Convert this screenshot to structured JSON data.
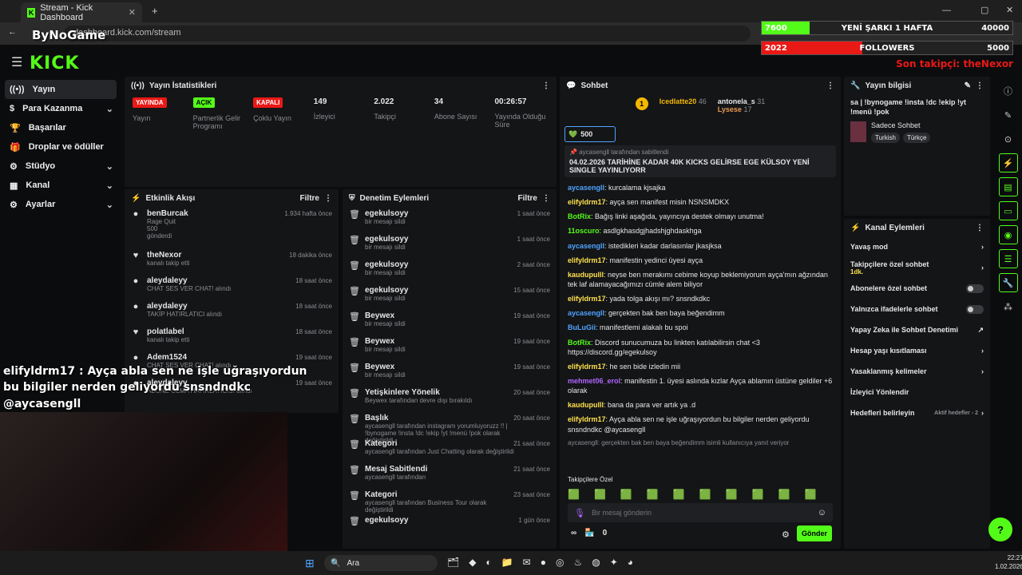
{
  "browser": {
    "tab_title": "Stream - Kick Dashboard",
    "url": "dashboard.kick.com/stream",
    "overlay_brand": "ByNoGame"
  },
  "overlay": {
    "goal1_cur": "7600",
    "goal1_label": "YENİ ŞARKI 1 HAFTA",
    "goal1_max": "40000",
    "goal1_fill": 0.19,
    "goal2_cur": "2022",
    "goal2_label": "FOLLOWERS",
    "goal2_max": "5000",
    "goal2_fill": 0.4,
    "last_follower": "Son takipçi: theNexor"
  },
  "logo": "KICK",
  "sidebar": [
    {
      "label": "Yayın",
      "icon": "broadcast-icon"
    },
    {
      "label": "Para Kazanma",
      "icon": "dollar-icon",
      "chev": true
    },
    {
      "label": "Başarılar",
      "icon": "trophy-icon"
    },
    {
      "label": "Droplar ve ödüller",
      "icon": "gift-icon"
    },
    {
      "label": "Stüdyo",
      "icon": "gear-icon",
      "chev": true
    },
    {
      "label": "Kanal",
      "icon": "channel-icon",
      "chev": true
    },
    {
      "label": "Ayarlar",
      "icon": "settings-icon",
      "chev": true
    }
  ],
  "stats": {
    "title": "Yayın İstatistikleri",
    "items": [
      {
        "badge": "YAYINDA",
        "label": "Yayın",
        "kind": "red"
      },
      {
        "badge": "AÇIK",
        "label": "Partnerlik Gelir Programı",
        "kind": "green"
      },
      {
        "badge": "KAPALI",
        "label": "Çoklu Yayın",
        "kind": "red"
      },
      {
        "value": "149",
        "label": "İzleyici"
      },
      {
        "value": "2.022",
        "label": "Takipçi"
      },
      {
        "value": "34",
        "label": "Abone Sayısı"
      },
      {
        "value": "00:26:57",
        "label": "Yayında Olduğu Süre"
      }
    ]
  },
  "activity": {
    "title": "Etkinlik Akışı",
    "filter": "Filtre",
    "items": [
      {
        "name": "benBurcak",
        "sub": "Rage Quit",
        "sub2": "500",
        "sub3": "gönderdi",
        "time": "1.934 hafta önce"
      },
      {
        "name": "theNexor",
        "sub": "kanalı takip etti",
        "time": "18 dakika önce"
      },
      {
        "name": "aleydaleyy",
        "sub": "CHAT SES VER CHAT! alındı",
        "time": "18 saat önce"
      },
      {
        "name": "aleydaleyy",
        "sub": "TAKİP HATIRLATICI alındı",
        "time": "18 saat önce"
      },
      {
        "name": "polatlabel",
        "sub": "kanalı takip etti",
        "time": "18 saat önce"
      },
      {
        "name": "Adem1524",
        "sub": "CHAT SES VER CHAT! alındı",
        "time": "19 saat önce"
      },
      {
        "name": "aleydaleyy",
        "sub": "ABONE OLMA HATIRLATICISI alındı",
        "time": "19 saat önce"
      }
    ]
  },
  "mod": {
    "title": "Denetim Eylemleri",
    "filter": "Filtre",
    "items": [
      {
        "name": "egekulsoyy",
        "sub": "bir mesajı sildi",
        "time": "1 saat önce"
      },
      {
        "name": "egekulsoyy",
        "sub": "bir mesajı sildi",
        "time": "1 saat önce"
      },
      {
        "name": "egekulsoyy",
        "sub": "bir mesajı sildi",
        "time": "2 saat önce"
      },
      {
        "name": "egekulsoyy",
        "sub": "bir mesajı sildi",
        "time": "15 saat önce"
      },
      {
        "name": "Beywex",
        "sub": "bir mesajı sildi",
        "time": "19 saat önce"
      },
      {
        "name": "Beywex",
        "sub": "bir mesajı sildi",
        "time": "19 saat önce"
      },
      {
        "name": "Beywex",
        "sub": "bir mesajı sildi",
        "time": "19 saat önce"
      },
      {
        "name": "Yetişkinlere Yönelik",
        "sub": "Beywex tarafından devre dışı bırakıldı",
        "time": "20 saat önce"
      },
      {
        "name": "Başlık",
        "sub": "aycasengll tarafından instagram yorumluyoruzz !! | !bynogame !insta !dc !ekip !yt !menü !pok olarak değiştirildi",
        "time": "20 saat önce"
      },
      {
        "name": "Kategori",
        "sub": "aycasengll tarafından Just Chatting olarak değiştirildi",
        "time": "21 saat önce"
      },
      {
        "name": "Mesaj Sabitlendi",
        "sub": "aycasengll tarafından",
        "time": "21 saat önce"
      },
      {
        "name": "Kategori",
        "sub": "aycasengll tarafından Business Tour olarak değiştirildi",
        "time": "23 saat önce"
      },
      {
        "name": "egekulsoyy",
        "sub": "",
        "time": "1 gün önce"
      }
    ]
  },
  "chat": {
    "title": "Sohbet",
    "top1": "Icedlatte20",
    "top1v": "46",
    "top2": "antonela_s",
    "top2v": "31",
    "top3": "Lysese",
    "top3v": "17",
    "kicks": "500",
    "pinned_by": "aycasengll tarafından sabitlendi",
    "pinned": "04.02.2026 TARİHİNE KADAR 40K KICKS GELİRSE EGE KÜLSOY YENİ SINGLE YAYINLIYORR",
    "lines": [
      {
        "u": "aycasengll",
        "c": "#4fa3ff",
        "t": "kurcalama kjsajka"
      },
      {
        "u": "elifyldrm17",
        "c": "#ffe14d",
        "t": "ayça sen manifest misin NSNSMDKX"
      },
      {
        "u": "BotRix",
        "c": "#53fc18",
        "t": "Bağış linki aşağıda, yayıncıya destek olmayı unutma!"
      },
      {
        "u": "11oscuro",
        "c": "#53fc18",
        "t": "asdlgkhasdgjhadshjghdaskhga"
      },
      {
        "u": "aycasengll",
        "c": "#4fa3ff",
        "t": "istedikleri kadar darlasınlar jkasjksa"
      },
      {
        "u": "elifyldrm17",
        "c": "#ffe14d",
        "t": "manifestin yedinci üyesi ayça"
      },
      {
        "u": "kaudupulll",
        "c": "#ffe14d",
        "t": "neyse ben merakımı cebime koyup beklemiyorum ayça'mın ağzından tek laf alamayacağımızı cümle alem biliyor"
      },
      {
        "u": "elifyldrm17",
        "c": "#ffe14d",
        "t": "yada tolga akışı mı? snsndkdkc"
      },
      {
        "u": "aycasengll",
        "c": "#4fa3ff",
        "t": "gerçekten bak ben baya beğendimm"
      },
      {
        "u": "BuLuGii",
        "c": "#4fa3ff",
        "t": "manifestlemi alakalı bu spoi"
      },
      {
        "u": "BotRix",
        "c": "#53fc18",
        "t": "Discord sunucumuza bu linkten katılabilirsin chat <3 https://discord.gg/egekulsoy"
      },
      {
        "u": "elifyldrm17",
        "c": "#ffe14d",
        "t": "he sen bide izledin mii"
      },
      {
        "u": "mehmet06_erol",
        "c": "#b066ff",
        "t": "manifestin 1. üyesi aslında kızlar Ayça ablamın üstüne geldiler +6 olarak"
      },
      {
        "u": "kaudupulll",
        "c": "#ffe14d",
        "t": "bana da para ver artık ya .d"
      },
      {
        "u": "elifyldrm17",
        "c": "#ffe14d",
        "t": "Ayça abla sen ne işle uğraşıyordun bu bilgiler nerden geliyordu snsndndkc @aycasengll"
      }
    ],
    "reply_note": "aycasengll: gerçekten bak ben baya beğendimm isimli kullanıcıya yanıt veriyor",
    "emote_label": "Takipçilere Özel",
    "placeholder": "Bir mesaj gönderin",
    "points": "0",
    "send": "Gönder"
  },
  "info": {
    "title": "Yayın bilgisi",
    "stream_title": "sa | !bynogame !insta !dc !ekip !yt !menü !pok",
    "category": "Sadece Sohbet",
    "tags": [
      "Turkish",
      "Türkçe"
    ]
  },
  "actions": {
    "title": "Kanal Eylemleri",
    "items": [
      {
        "label": "Yavaş mod",
        "type": "chev"
      },
      {
        "label": "Takipçilere özel sohbet",
        "sub": "1dk.",
        "type": "chev"
      },
      {
        "label": "Abonelere özel sohbet",
        "type": "toggle"
      },
      {
        "label": "Yalnızca ifadelerle sohbet",
        "type": "toggle"
      },
      {
        "label": "Yapay Zeka ile Sohbet Denetimi",
        "type": "ext"
      },
      {
        "label": "Hesap yaşı kısıtlaması",
        "type": "chev"
      },
      {
        "label": "Yasaklanmış kelimeler",
        "type": "chev"
      },
      {
        "label": "İzleyici Yönlendir",
        "type": "none"
      },
      {
        "label": "Hedefleri belirleyin",
        "sub": "Aktif hedefler - 2",
        "type": "chev"
      }
    ]
  },
  "caption": [
    "elifyldrm17 : Ayça abla sen ne işle uğraşıyordun",
    "bu bilgiler nerden geliyordu snsndndkc",
    "@aycasengll"
  ],
  "taskbar": {
    "search": "Ara",
    "time": "22:27",
    "date": "1.02.2026"
  }
}
